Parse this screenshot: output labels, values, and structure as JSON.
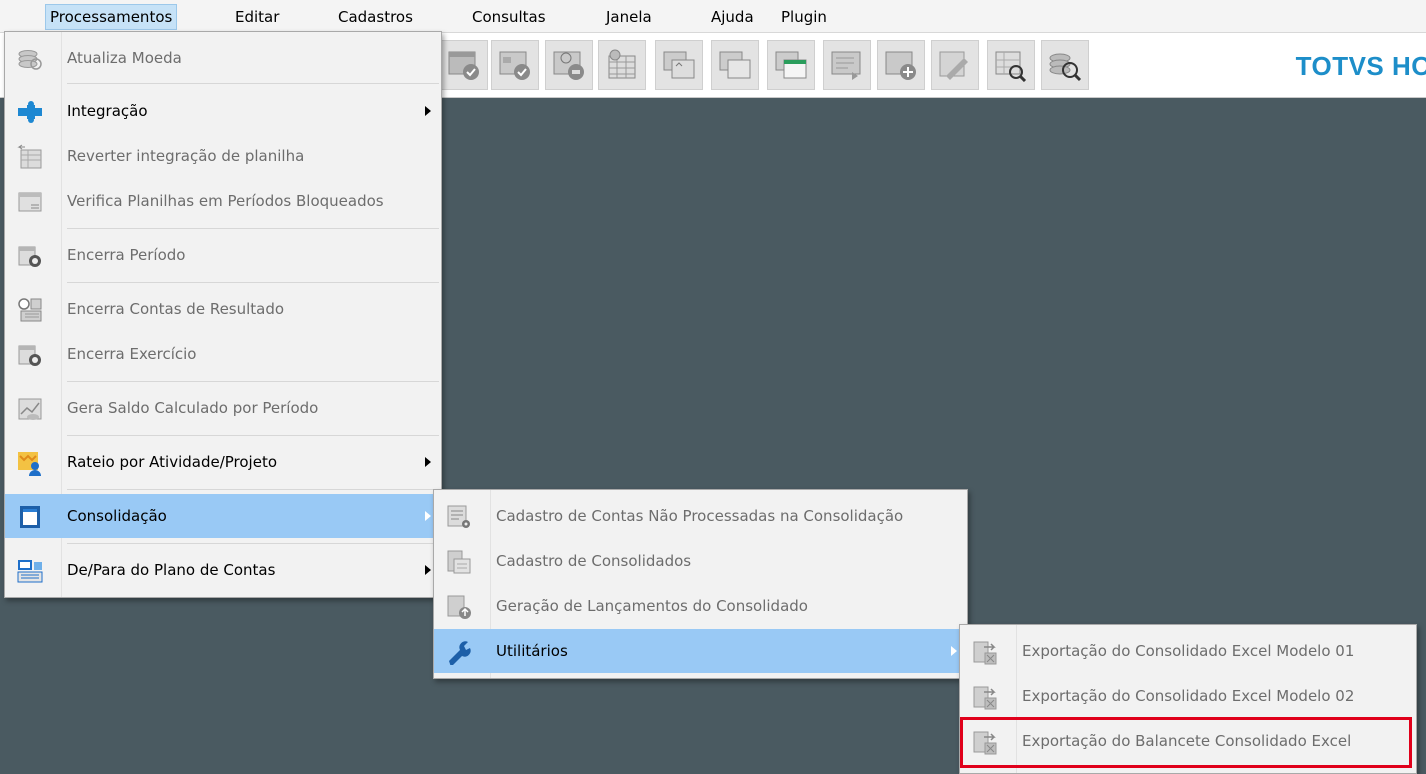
{
  "menubar": {
    "items": [
      "Processamentos",
      "Editar",
      "Cadastros",
      "Consultas",
      "Janela",
      "Ajuda",
      "Plugin"
    ],
    "active": "Processamentos"
  },
  "brand": "TOTVS HO",
  "processamentos_menu": {
    "items": [
      {
        "label": "Atualiza Moeda",
        "icon": "coins-refresh-icon",
        "enabled": false,
        "submenu": false
      },
      {
        "label": "Integração",
        "icon": "puzzle-icon",
        "enabled": true,
        "submenu": true
      },
      {
        "label": "Reverter integração de planilha",
        "icon": "sheet-revert-icon",
        "enabled": false,
        "submenu": false
      },
      {
        "label": "Verifica Planilhas em Períodos Bloqueados",
        "icon": "sheet-check-icon",
        "enabled": false,
        "submenu": false
      },
      {
        "label": "Encerra Período",
        "icon": "calendar-close-icon",
        "enabled": false,
        "submenu": false
      },
      {
        "label": "Encerra Contas de Resultado",
        "icon": "accounts-close-icon",
        "enabled": false,
        "submenu": false
      },
      {
        "label": "Encerra Exercício",
        "icon": "calendar-close-icon",
        "enabled": false,
        "submenu": false
      },
      {
        "label": "Gera Saldo Calculado por Período",
        "icon": "chart-calc-icon",
        "enabled": false,
        "submenu": false
      },
      {
        "label": "Rateio por Atividade/Projeto",
        "icon": "project-people-icon",
        "enabled": true,
        "submenu": true
      },
      {
        "label": "Consolidação",
        "icon": "book-icon",
        "enabled": true,
        "submenu": true,
        "highlighted": true
      },
      {
        "label": "De/Para do Plano de Contas",
        "icon": "mapping-icon",
        "enabled": true,
        "submenu": true
      }
    ]
  },
  "consolidacao_menu": {
    "items": [
      {
        "label": "Cadastro de Contas Não Processadas na Consolidação",
        "icon": "list-gear-icon",
        "enabled": false,
        "submenu": false
      },
      {
        "label": "Cadastro de Consolidados",
        "icon": "consolidated-icon",
        "enabled": false,
        "submenu": false
      },
      {
        "label": "Geração de Lançamentos do Consolidado",
        "icon": "generate-icon",
        "enabled": false,
        "submenu": false
      },
      {
        "label": "Utilitários",
        "icon": "wrench-icon",
        "enabled": true,
        "submenu": true,
        "highlighted": true
      }
    ]
  },
  "utilitarios_menu": {
    "items": [
      {
        "label": "Exportação do Consolidado Excel Modelo 01",
        "icon": "excel-export-icon",
        "enabled": false
      },
      {
        "label": "Exportação do Consolidado Excel Modelo 02",
        "icon": "excel-export-icon",
        "enabled": false
      },
      {
        "label": "Exportação do Balancete Consolidado Excel",
        "icon": "excel-export-icon",
        "enabled": false,
        "marked": true
      }
    ]
  },
  "colors": {
    "background": "#4a5a61",
    "highlight": "#99c9f5",
    "brand": "#1d8ec9",
    "marker": "#e0001b"
  }
}
